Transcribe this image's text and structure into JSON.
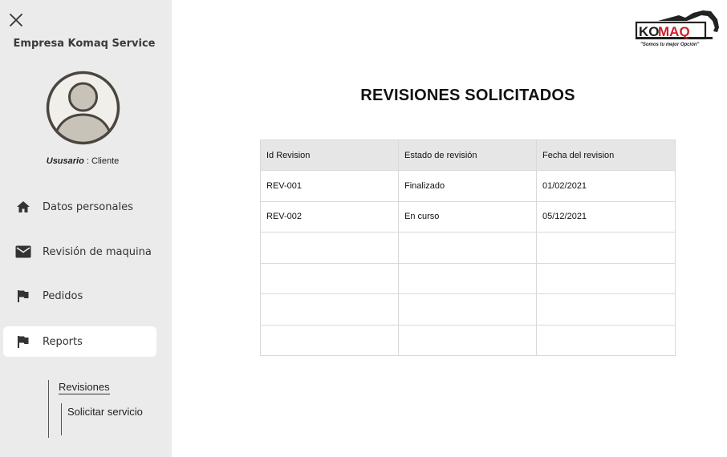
{
  "sidebar": {
    "company": "Empresa Komaq Service",
    "user_label": "Ususario",
    "user_sep": " : ",
    "user_role": "Cliente",
    "items": [
      {
        "label": "Datos personales",
        "icon": "home-icon"
      },
      {
        "label": "Revisión de maquina",
        "icon": "mail-icon"
      },
      {
        "label": "Pedidos",
        "icon": "flag-icon"
      },
      {
        "label": "Reports",
        "icon": "flag-icon",
        "active": true
      }
    ],
    "submenu": {
      "revisiones": "Revisiones",
      "solicitar": "Solicitar servicio"
    }
  },
  "logo": {
    "brand_ko": "KO",
    "brand_maq": "MAQ",
    "tagline": "\"Somos tu mejor Opción\""
  },
  "main": {
    "title": "REVISIONES SOLICITADOS",
    "table": {
      "headers": [
        "Id Revision",
        "Estado de revisión",
        "Fecha del revision"
      ],
      "rows": [
        [
          "REV-001",
          "Finalizado",
          "01/02/2021"
        ],
        [
          "REV-002",
          "En curso",
          "05/12/2021"
        ],
        [
          "",
          "",
          ""
        ],
        [
          "",
          "",
          ""
        ],
        [
          "",
          "",
          ""
        ],
        [
          "",
          "",
          ""
        ]
      ]
    }
  },
  "colors": {
    "sidebar_bg": "#ebebeb",
    "header_bg": "#e6e6e6",
    "logo_red": "#d0202a"
  }
}
